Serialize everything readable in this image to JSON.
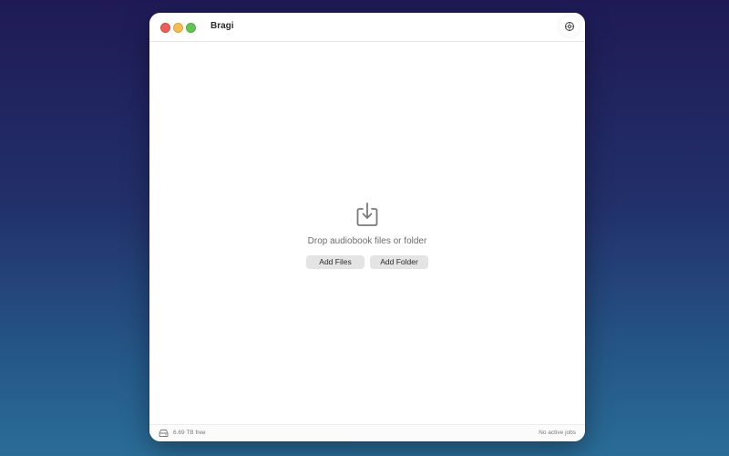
{
  "window": {
    "title": "Bragi",
    "controls": {
      "close": "close",
      "minimize": "minimize",
      "maximize": "maximize"
    }
  },
  "toolbar": {
    "settings_icon": "gear-icon"
  },
  "drop_zone": {
    "icon": "download-tray-icon",
    "message": "Drop audiobook files or folder",
    "add_files_label": "Add Files",
    "add_folder_label": "Add Folder"
  },
  "status_bar": {
    "disk_icon": "hard-drive-icon",
    "free_space": "6.69 TB free",
    "jobs_status": "No active jobs"
  },
  "colors": {
    "close": "#ec5f57",
    "minimize": "#f4bd4f",
    "maximize": "#61c554",
    "button_bg": "#e4e4e4",
    "icon_gray": "#7a7a7a"
  }
}
